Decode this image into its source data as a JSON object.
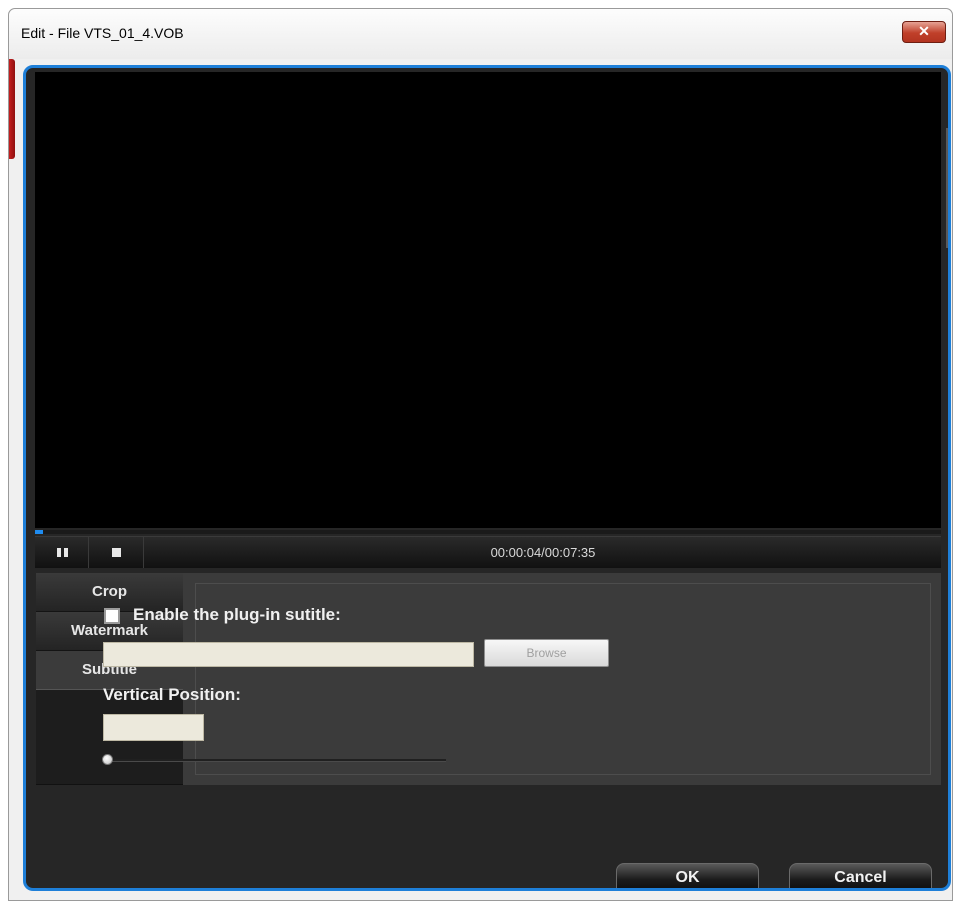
{
  "window": {
    "title": "Edit - File VTS_01_4.VOB",
    "close_glyph": "✕"
  },
  "player": {
    "time": "00:00:04/00:07:35",
    "progress_fraction": 0.0088,
    "pause_icon": "pause-icon",
    "stop_icon": "stop-icon",
    "accent_color": "#1e7fd8"
  },
  "tabs": [
    {
      "label": "Crop",
      "selected": false
    },
    {
      "label": "Watermark",
      "selected": false
    },
    {
      "label": "Subtitle",
      "selected": true
    }
  ],
  "subtitle": {
    "enable_label": "Enable the plug-in sutitle:",
    "enabled": false,
    "file_value": "",
    "browse_label": "Browse",
    "vertical_position_label": "Vertical Position:",
    "vertical_position_value": "",
    "slider_fraction": 0.0
  },
  "footer": {
    "ok_label": "OK",
    "cancel_label": "Cancel"
  }
}
